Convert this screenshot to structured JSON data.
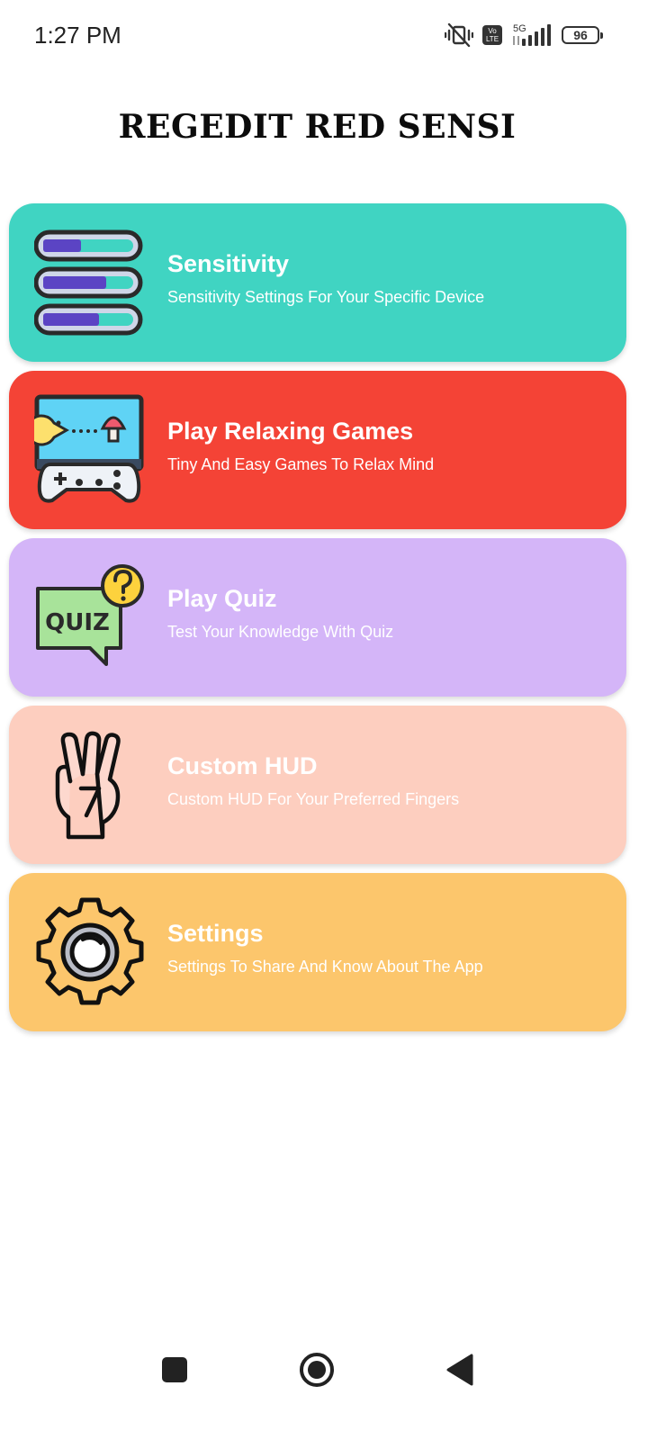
{
  "status_bar": {
    "time": "1:27 PM",
    "icons": [
      "vibrate-mute-icon",
      "volte-icon",
      "signal-5g-icon",
      "battery-icon"
    ],
    "volte_line1": "Vo",
    "volte_line2": "LTE",
    "network": "5G",
    "battery_level": "96"
  },
  "app": {
    "title": "REGEDIT RED SENSI"
  },
  "menu": [
    {
      "title": "Sensitivity",
      "subtitle": "Sensitivity Settings For Your Specific Device",
      "icon": "sensitivity-sliders-icon",
      "color": "#40d4c2"
    },
    {
      "title": "Play Relaxing Games",
      "subtitle": "Tiny And Easy Games To Relax Mind",
      "icon": "game-console-icon",
      "color": "#f44336"
    },
    {
      "title": "Play Quiz",
      "subtitle": "Test Your Knowledge With Quiz",
      "icon": "quiz-bubble-icon",
      "icon_text": "QUIZ",
      "color": "#d4b5f8"
    },
    {
      "title": "Custom HUD",
      "subtitle": "Custom HUD For Your Preferred Fingers",
      "icon": "three-fingers-hand-icon",
      "color": "#fdcebf"
    },
    {
      "title": "Settings",
      "subtitle": "Settings To Share And Know About The App",
      "icon": "gear-icon",
      "color": "#fcc66c"
    }
  ],
  "nav_bar": {
    "buttons": [
      "recents-square-icon",
      "home-circle-icon",
      "back-triangle-icon"
    ]
  }
}
